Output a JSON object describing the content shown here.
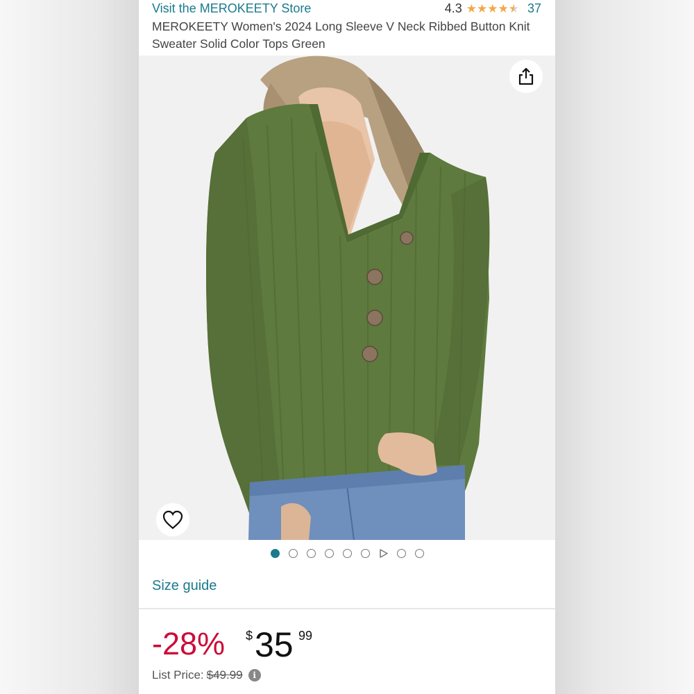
{
  "header": {
    "store_link": "Visit the MEROKEETY Store",
    "rating_value": "4.3",
    "rating_count": "37",
    "title": "MEROKEETY Women's 2024 Long Sleeve V Neck Ribbed Button Knit Sweater Solid Color Tops Green"
  },
  "rating": {
    "stars": 4.3,
    "max": 5
  },
  "image": {
    "share_icon": "share-icon",
    "wishlist_icon": "heart-icon"
  },
  "carousel": {
    "active_index": 0,
    "items": [
      "dot",
      "dot",
      "dot",
      "dot",
      "dot",
      "dot",
      "video",
      "dot",
      "dot"
    ]
  },
  "links": {
    "size_guide": "Size guide"
  },
  "price": {
    "discount": "-28%",
    "currency_symbol": "$",
    "whole": "35",
    "fraction": "99",
    "list_price_label": "List Price:",
    "list_price_value": "$49.99",
    "info_icon": "i"
  },
  "colors": {
    "link": "#1a7a8c",
    "discount": "#cc0c39",
    "star": "#f3a847",
    "sweater": "#5e7a3e"
  }
}
